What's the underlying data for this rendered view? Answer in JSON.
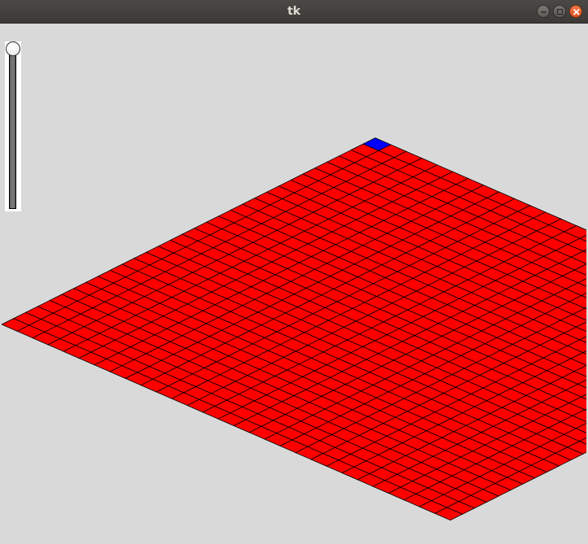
{
  "window": {
    "title": "tk"
  },
  "grid": {
    "tile_color": "#ff0000",
    "line_color": "#000000",
    "selected_color": "#0000ff"
  },
  "scale": {
    "value": 0
  }
}
